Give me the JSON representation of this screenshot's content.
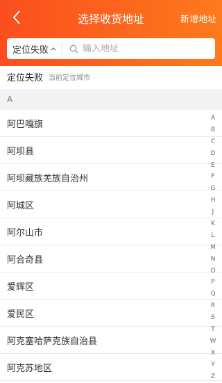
{
  "header": {
    "title": "选择收货地址",
    "add_label": "新增地址"
  },
  "search": {
    "location_status": "定位失败",
    "placeholder": "输入地址"
  },
  "current_location": {
    "status": "定位失败",
    "hint": "当前定位城市"
  },
  "section": {
    "letter": "A"
  },
  "cities": [
    "阿巴嘎旗",
    "阿坝县",
    "阿坝藏族羌族自治州",
    "阿城区",
    "阿尔山市",
    "阿合奇县",
    "爱辉区",
    "爱民区",
    "阿克塞哈萨克族自治县",
    "阿克苏地区"
  ],
  "index_letters": [
    "A",
    "B",
    "C",
    "D",
    "E",
    "F",
    "G",
    "H",
    "J",
    "K",
    "L",
    "M",
    "N",
    "O",
    "P",
    "Q",
    "R",
    "S",
    "T",
    "W",
    "X",
    "Y",
    "Z"
  ],
  "colors": {
    "header_start": "#fb4e1f",
    "header_end": "#fd7a1b",
    "section_bg": "#f2f2f2"
  }
}
